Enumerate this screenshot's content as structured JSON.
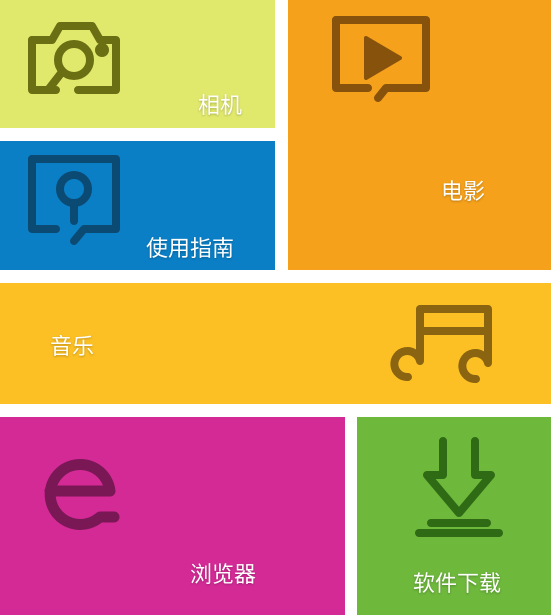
{
  "tiles": [
    {
      "id": "camera",
      "label": "相机",
      "color": "#e1e96c",
      "icon": "camera-icon"
    },
    {
      "id": "guide",
      "label": "使用指南",
      "color": "#0a7fc6",
      "icon": "help-icon"
    },
    {
      "id": "movie",
      "label": "电影",
      "color": "#f5a11b",
      "icon": "play-icon"
    },
    {
      "id": "music",
      "label": "音乐",
      "color": "#fcc024",
      "icon": "music-note-icon"
    },
    {
      "id": "browser",
      "label": "浏览器",
      "color": "#d42a96",
      "icon": "browser-e-icon"
    },
    {
      "id": "download",
      "label": "软件下载",
      "color": "#6eb83c",
      "icon": "download-icon"
    }
  ]
}
